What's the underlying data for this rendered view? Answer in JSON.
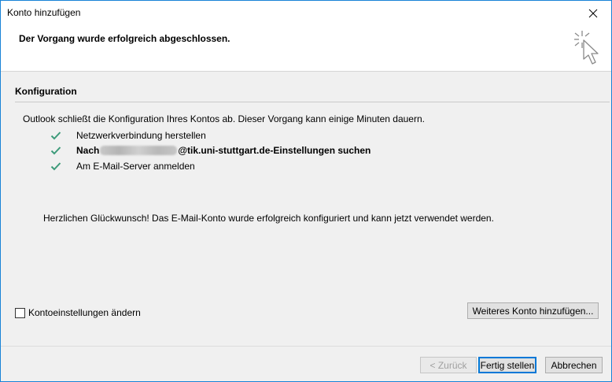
{
  "window": {
    "title": "Konto hinzufügen"
  },
  "header": {
    "title": "Der Vorgang wurde erfolgreich abgeschlossen."
  },
  "section": {
    "title": "Konfiguration"
  },
  "intro": "Outlook schließt die Konfiguration Ihres Kontos ab. Dieser Vorgang kann einige Minuten dauern.",
  "steps": [
    {
      "label": "Netzwerkverbindung herstellen",
      "status": "done"
    },
    {
      "prefix": "Nach",
      "suffix": "@tik.uni-stuttgart.de-Einstellungen suchen",
      "status": "done"
    },
    {
      "label": "Am E-Mail-Server anmelden",
      "status": "done"
    }
  ],
  "congrats": "Herzlichen Glückwunsch! Das E-Mail-Konto wurde erfolgreich konfiguriert und kann jetzt verwendet werden.",
  "options": {
    "change_settings_label": "Kontoeinstellungen ändern",
    "change_settings_checked": false
  },
  "buttons": {
    "add_another": "Weiteres Konto hinzufügen...",
    "back": "< Zurück",
    "finish": "Fertig stellen",
    "cancel": "Abbrechen"
  },
  "colors": {
    "check": "#3c9a79",
    "accent": "#0078d7",
    "window_border": "#1883d7"
  },
  "icons": [
    "close-icon",
    "wizard-cursor-icon",
    "checkmark-icon",
    "checkbox-icon"
  ]
}
